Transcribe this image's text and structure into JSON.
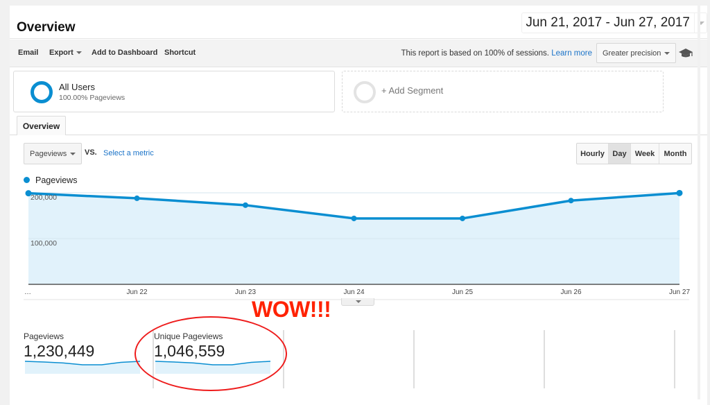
{
  "header": {
    "title": "Overview",
    "date_range": "Jun 21, 2017 - Jun 27, 2017"
  },
  "toolbar": {
    "email": "Email",
    "export": "Export",
    "add_to_dashboard": "Add to Dashboard",
    "shortcut": "Shortcut",
    "sampling_text": "This report is based on 100% of sessions.",
    "learn_more": "Learn more",
    "precision": "Greater precision",
    "icons": {
      "precision_caret": "caret-down-icon",
      "education": "graduation-cap-icon"
    }
  },
  "segments": {
    "all_users_name": "All Users",
    "all_users_sub": "100.00% Pageviews",
    "add_segment": "+ Add Segment"
  },
  "tabs": [
    {
      "label": "Overview",
      "active": true
    }
  ],
  "chart_controls": {
    "metric": "Pageviews",
    "vs": "VS.",
    "select_metric": "Select a metric",
    "granularity": [
      {
        "label": "Hourly",
        "active": false
      },
      {
        "label": "Day",
        "active": true
      },
      {
        "label": "Week",
        "active": false
      },
      {
        "label": "Month",
        "active": false
      }
    ]
  },
  "colors": {
    "series": "#0a8ed1",
    "fill": "#e1f2fb",
    "annotation": "#ff2200",
    "link": "#1a73c8"
  },
  "chart_data": {
    "type": "area",
    "legend": [
      "Pageviews"
    ],
    "legend_position": "top-left",
    "categories": [
      "…",
      "Jun 22",
      "Jun 23",
      "Jun 24",
      "Jun 25",
      "Jun 26",
      "Jun 27"
    ],
    "dates": [
      "Jun 21",
      "Jun 22",
      "Jun 23",
      "Jun 24",
      "Jun 25",
      "Jun 26",
      "Jun 27"
    ],
    "series": [
      {
        "name": "Pageviews",
        "values": [
          199000,
          188000,
          173000,
          144000,
          144000,
          183000,
          199449
        ]
      }
    ],
    "yticks": [
      {
        "value": 100000,
        "label": "100,000"
      },
      {
        "value": 200000,
        "label": "200,000"
      }
    ],
    "ylim": [
      0,
      200000
    ],
    "grid": true,
    "title": "",
    "xlabel": "",
    "ylabel": ""
  },
  "scorecards": [
    {
      "label": "Pageviews",
      "value": "1,230,449"
    },
    {
      "label": "Unique Pageviews",
      "value": "1,046,559"
    },
    {
      "label": "",
      "value": ""
    },
    {
      "label": "",
      "value": ""
    },
    {
      "label": "",
      "value": ""
    }
  ],
  "annotation": {
    "text": "WOW!!!"
  }
}
